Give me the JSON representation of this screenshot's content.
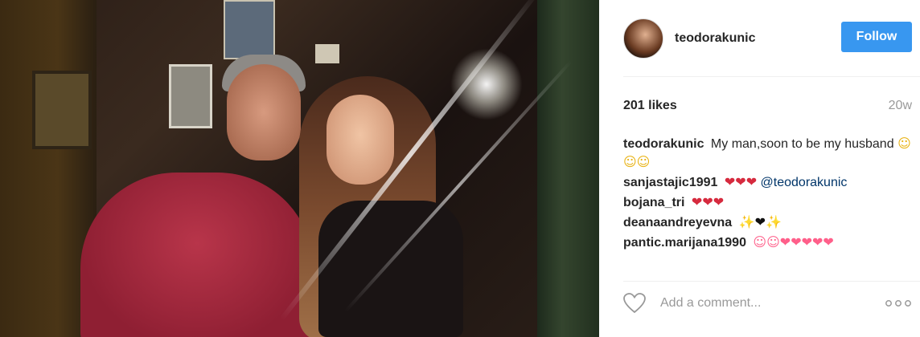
{
  "post": {
    "username": "teodorakunic",
    "follow_label": "Follow",
    "likes": "201 likes",
    "age": "20w"
  },
  "comments": [
    {
      "user": "teodorakunic",
      "text": "My man,soon to be my husband",
      "emoji": "☺☺☺"
    },
    {
      "user": "sanjastajic1991",
      "emoji": "❤❤❤",
      "mention": "@teodorakunic"
    },
    {
      "user": "bojana_tri",
      "emoji": "❤❤❤"
    },
    {
      "user": "deanaandreyevna",
      "emoji": "✨❤✨"
    },
    {
      "user": "pantic.marijana1990",
      "emoji": "☺☺❤❤❤❤❤"
    }
  ],
  "add_comment": {
    "placeholder": "Add a comment..."
  },
  "icons": {
    "like": "heart-outline-icon",
    "more": "more-options-icon"
  },
  "colors": {
    "follow_button": "#3897f0",
    "muted_text": "#999999"
  }
}
